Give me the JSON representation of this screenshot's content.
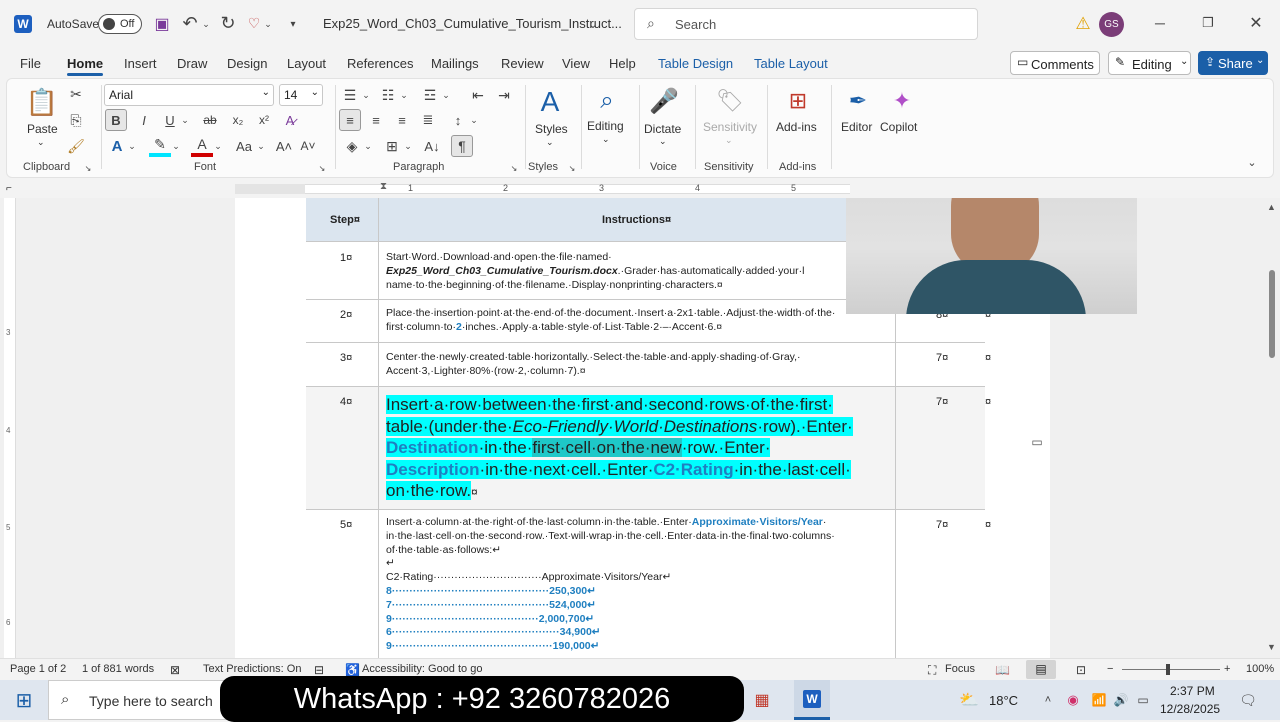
{
  "titlebar": {
    "autosave_label": "AutoSave",
    "autosave_state": "Off",
    "doc_title": "Exp25_Word_Ch03_Cumulative_Tourism_Instruct...",
    "search_placeholder": "Search",
    "user_initials": "GS"
  },
  "menu": {
    "file": "File",
    "home": "Home",
    "insert": "Insert",
    "draw": "Draw",
    "design": "Design",
    "layout": "Layout",
    "references": "References",
    "mailings": "Mailings",
    "review": "Review",
    "view": "View",
    "help": "Help",
    "table_design": "Table Design",
    "table_layout": "Table Layout",
    "comments": "Comments",
    "editing": "Editing",
    "share": "Share"
  },
  "ribbon": {
    "paste": "Paste",
    "font_name": "Arial",
    "font_size": "14",
    "styles": "Styles",
    "editing": "Editing",
    "dictate": "Dictate",
    "sensitivity": "Sensitivity",
    "addins": "Add-ins",
    "editor": "Editor",
    "copilot": "Copilot",
    "groups": {
      "clipboard": "Clipboard",
      "font": "Font",
      "paragraph": "Paragraph",
      "styles": "Styles",
      "voice": "Voice",
      "sensitivity": "Sensitivity",
      "addins": "Add-ins"
    }
  },
  "table": {
    "header_step": "Step¤",
    "header_instructions": "Instructions¤",
    "rows": [
      {
        "step": "1¤",
        "points": ""
      },
      {
        "step": "2¤",
        "points": "8¤"
      },
      {
        "step": "3¤",
        "points": "7¤"
      },
      {
        "step": "4¤",
        "points": "7¤"
      },
      {
        "step": "5¤",
        "points": "7¤"
      }
    ],
    "row1_a": "Start·Word.·Download·and·open·the·file·named·",
    "row1_b": "Exp25_Word_Ch03_Cumulative_Tourism.docx",
    "row1_c": ".·Grader·has·automatically·added·your·l",
    "row1_d": "name·to·the·beginning·of·the·filename.·Display·nonprinting·characters.¤",
    "row2_a": "Place·the·insertion·point·at·the·end·of·the·document.·Insert·a·2x1·table.·Adjust·the·width·of·the·",
    "row2_b": "first·column·to·",
    "row2_c": "2",
    "row2_d": "·inches.·Apply·a·table·style·of·List·Table·2·–·Accent·6.¤",
    "row3_a": "Center·the·newly·created·table·horizontally.·Select·the·table·and·apply·shading·of·Gray,·",
    "row3_b": "Accent·3,·Lighter·80%·(row·2,·column·7).¤",
    "row4_l1": "Insert·a·row·between·the·first·and·second·rows·of·the·first·",
    "row4_l2a": "table·(under·the·",
    "row4_l2b": "Eco-Friendly·World·Destinations",
    "row4_l2c": "·row).·Enter·",
    "row4_l3a": "Destination",
    "row4_l3b": "·in·the·",
    "row4_l3c": "first·cell·on·the·new",
    "row4_l3d": "·row.·Enter·",
    "row4_l4a": "Description",
    "row4_l4b": "·in·the·next·cell.·Enter·",
    "row4_l4c": "C2·Rating",
    "row4_l4d": "·in·the·last·cell·",
    "row4_l5": "on·the·row.",
    "row4_end": "¤",
    "row5_a": "Insert·a·column·at·the·right·of·the·last·column·in·the·table.·Enter·",
    "row5_b": "Approximate·Visitors/Year",
    "row5_c": "·",
    "row5_d": "in·the·last·cell·on·the·second·row.·Text·will·wrap·in·the·cell.·Enter·data·in·the·final·two·columns·",
    "row5_e": "of·the·table·as·follows:↵",
    "row5_f": "↵",
    "row5_hdr": "C2·Rating·······························Approximate·Visitors/Year↵",
    "row5_data": [
      "8·············································250,300↵",
      "7·············································524,000↵",
      "9··········································2,000,700↵",
      "6················································34,900↵",
      "9··············································190,000↵"
    ],
    "end_mark": "¤"
  },
  "status": {
    "page": "Page 1 of 2",
    "words": "1 of 881 words",
    "predictions": "Text Predictions: On",
    "accessibility": "Accessibility: Good to go",
    "focus": "Focus",
    "zoom": "100%"
  },
  "taskbar": {
    "search_placeholder": "Type here to search",
    "banner": "WhatsApp : +92 3260782026",
    "temperature": "18°C",
    "time": "2:37 PM",
    "date": "12/28/2025"
  },
  "colors": {
    "accent_blue": "#1b5fa8",
    "highlight": "#00ffff",
    "teal_text": "#1f7fc0",
    "header_fill": "#dbe5ef"
  }
}
